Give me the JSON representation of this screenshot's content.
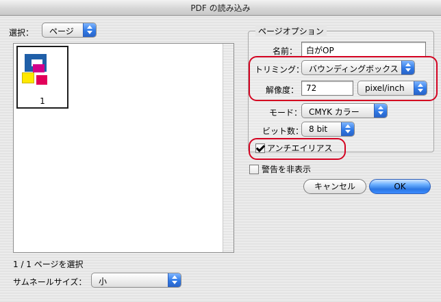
{
  "window": {
    "title": "PDF の読み込み"
  },
  "left": {
    "select_label": "選択：",
    "select_value": "ページ",
    "thumbnail_page_number": "1",
    "status_text": "1 / 1 ページを選択",
    "thumbnail_size_label": "サムネールサイズ：",
    "thumbnail_size_value": "小"
  },
  "page_options": {
    "group_title": "ページオプション",
    "name_label": "名前：",
    "name_value": "白がOP",
    "trim_label": "トリミング：",
    "trim_value": "バウンディングボックス",
    "resolution_label": "解像度：",
    "resolution_value": "72",
    "resolution_unit": "pixel/inch",
    "mode_label": "モード：",
    "mode_value": "CMYK カラー",
    "bitdepth_label": "ビット数：",
    "bitdepth_value": "8 bit",
    "antialias_label": "アンチエイリアス",
    "antialias_checked": true
  },
  "warnings": {
    "hide_warnings_label": "警告を非表示",
    "hide_warnings_checked": false
  },
  "buttons": {
    "cancel": "キャンセル",
    "ok": "OK"
  },
  "colors": {
    "accent_blue": "#2f79e6",
    "annotation_red": "#d4001f",
    "thumb_blue": "#1f5fa8",
    "thumb_red": "#e2005a",
    "thumb_yellow": "#ffe800",
    "thumb_magenta": "#d1008a"
  },
  "icons": {
    "popup_arrows": "updown-arrows-icon",
    "checkbox": "checkbox-icon"
  }
}
